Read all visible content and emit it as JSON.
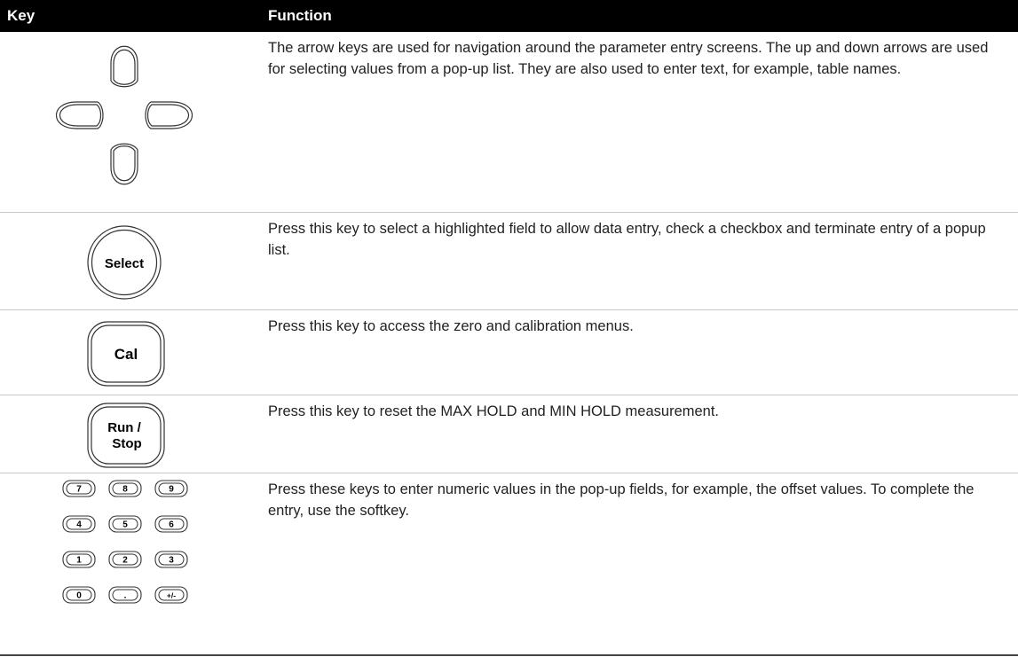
{
  "table": {
    "headers": {
      "key": "Key",
      "function": "Function"
    },
    "rows": [
      {
        "key": "arrow-keys",
        "function": "The arrow keys are used for navigation around the parameter entry screens. The up and down arrows are used for selecting values from a pop-up list. They are also used to enter text, for example, table names."
      },
      {
        "key": "Select",
        "function": "Press this key to select a highlighted field to allow data entry, check a checkbox and terminate entry of a popup list."
      },
      {
        "key": "Cal",
        "function": "Press this key to access the zero and calibration menus."
      },
      {
        "key": "Run / Stop",
        "key_lines": [
          "Run /",
          "Stop"
        ],
        "function": "Press this key to reset the MAX HOLD and MIN HOLD measurement."
      },
      {
        "key": "numeric-keypad",
        "keypad": [
          "7",
          "8",
          "9",
          "4",
          "5",
          "6",
          "1",
          "2",
          "3",
          "0",
          ".",
          "+/-"
        ],
        "function": "Press these keys to enter numeric values in the pop-up fields, for example, the offset values. To complete the entry, use the softkey."
      }
    ]
  }
}
